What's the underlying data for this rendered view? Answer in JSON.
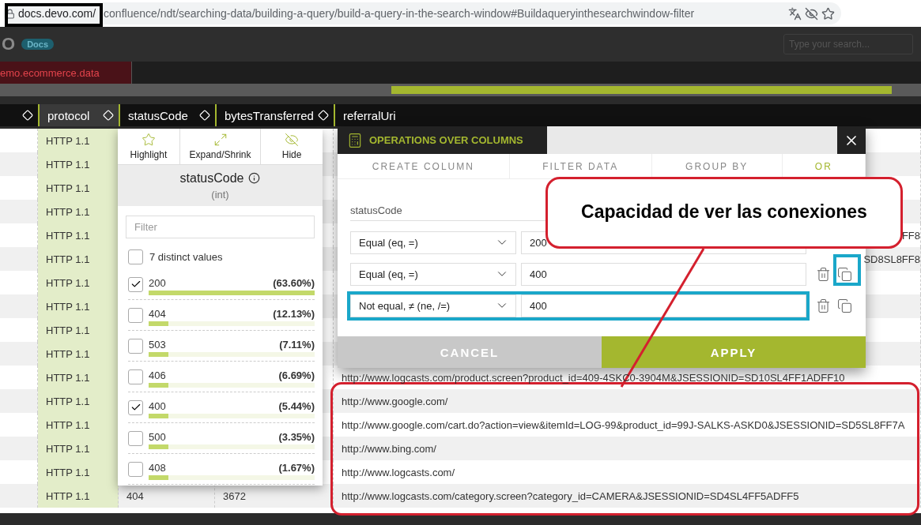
{
  "browser": {
    "url_host": "docs.devo.com/",
    "url_path": "confluence/ndt/searching-data/building-a-query/build-a-query-in-the-search-window#Buildaqueryinthesearchwindow-filter"
  },
  "app_header": {
    "logo": "O",
    "badge": "Docs",
    "search_placeholder": "Type your search..."
  },
  "query_tab": {
    "label": "emo.ecommerce.data",
    "selected": true
  },
  "columns": [
    {
      "highlighted": false
    },
    {
      "label": "protocol",
      "highlighted": true
    },
    {
      "label": "statusCode",
      "highlighted": false
    },
    {
      "label": "bytesTransferred",
      "highlighted": false
    },
    {
      "label": "referralUri",
      "highlighted": false
    }
  ],
  "rows": [
    {
      "protocol": "HTTP 1.1"
    },
    {
      "protocol": "HTTP 1.1"
    },
    {
      "protocol": "HTTP 1.1"
    },
    {
      "protocol": "HTTP 1.1"
    },
    {
      "protocol": "HTTP 1.1",
      "referral_uri": "FF8"
    },
    {
      "protocol": "HTTP 1.1",
      "referral_uri": "SD8SL8FF8"
    },
    {
      "protocol": "HTTP 1.1"
    },
    {
      "protocol": "HTTP 1.1"
    },
    {
      "protocol": "HTTP 1.1"
    },
    {
      "protocol": "HTTP 1.1"
    },
    {
      "protocol": "HTTP 1.1",
      "referral_uri": "http://www.logcasts.com/product.screen?product_id=409-4SKC0-3904M&JSESSIONID=SD10SL4FF1ADFF10"
    },
    {
      "protocol": "HTTP 1.1",
      "referral_uri": "http://www.google.com/"
    },
    {
      "protocol": "HTTP 1.1",
      "referral_uri": "http://www.google.com/cart.do?action=view&itemId=LOG-99&product_id=99J-SALKS-ASKD0&JSESSIONID=SD5SL8FF7A"
    },
    {
      "protocol": "HTTP 1.1",
      "referral_uri": "http://www.bing.com/"
    },
    {
      "protocol": "HTTP 1.1",
      "referral_uri": "http://www.logcasts.com/"
    },
    {
      "protocol": "HTTP 1.1",
      "status_code": "404",
      "bytes_transferred": "3672",
      "referral_uri": "http://www.logcasts.com/category.screen?category_id=CAMERA&JSESSIONID=SD4SL4FF5ADFF5"
    }
  ],
  "column_menu": {
    "actions": [
      {
        "kind": "highlight",
        "label": "Highlight"
      },
      {
        "kind": "expand",
        "label": "Expand/Shrink"
      },
      {
        "kind": "hide",
        "label": "Hide"
      }
    ],
    "title": "statusCode",
    "type": "(int)",
    "filter_placeholder": "Filter",
    "all_values": {
      "label": "7 distinct values",
      "checked": false
    },
    "values": [
      {
        "value": "200",
        "share": "(63.60%)",
        "checked": true,
        "level": 1
      },
      {
        "value": "404",
        "share": "(12.13%)",
        "checked": false,
        "level": 0.12
      },
      {
        "value": "503",
        "share": "(7.11%)",
        "checked": false,
        "level": 0.12
      },
      {
        "value": "406",
        "share": "(6.69%)",
        "checked": false,
        "level": 0.12
      },
      {
        "value": "400",
        "share": "(5.44%)",
        "checked": true,
        "level": 0.12
      },
      {
        "value": "500",
        "share": "(3.35%)",
        "checked": false,
        "level": 0.12
      },
      {
        "value": "408",
        "share": "(1.67%)",
        "checked": false,
        "level": 0.12
      }
    ]
  },
  "operations": {
    "title": "OPERATIONS OVER COLUMNS",
    "tabs": [
      {
        "label": "CREATE COLUMN",
        "selected": false
      },
      {
        "label": "FILTER DATA",
        "selected": false
      },
      {
        "label": "GROUP BY",
        "selected": false
      },
      {
        "label": "OR",
        "selected": true
      }
    ],
    "field": "statusCode",
    "conditions": [
      {
        "operator": "Equal (eq, =)",
        "value": "200",
        "tools": false,
        "highlighted": false
      },
      {
        "operator": "Equal (eq, =)",
        "value": "400",
        "tools": true,
        "highlighted": false
      },
      {
        "operator": "Not equal, ≠ (ne, /=)",
        "value": "400",
        "tools": true,
        "highlighted": true
      }
    ],
    "buttons": [
      {
        "kind": "cancel",
        "label": "CANCEL"
      },
      {
        "kind": "apply",
        "label": "APPLY"
      }
    ]
  },
  "callout": "Capacidad de ver las conexiones"
}
